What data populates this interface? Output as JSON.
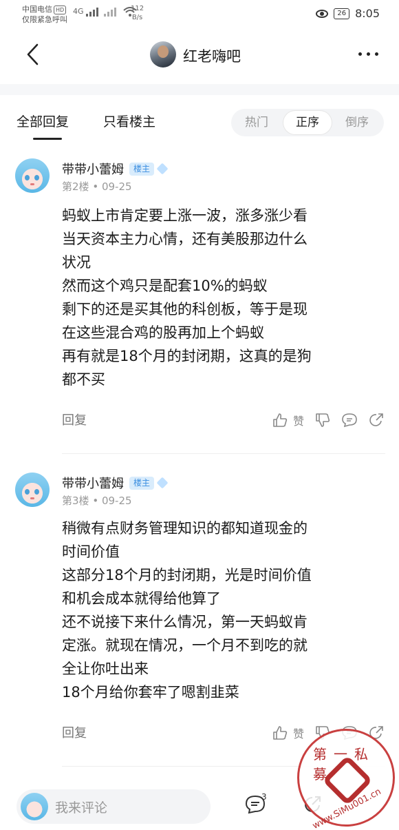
{
  "status_bar": {
    "carrier": "中国电信",
    "hd_badge": "HD",
    "emergency": "仅限紧急呼叫",
    "net_type": "4G",
    "speed_value": "112",
    "speed_unit": "B/s",
    "battery": "26",
    "time": "8:05"
  },
  "header": {
    "title": "红老嗨吧"
  },
  "tabs": {
    "all_replies": "全部回复",
    "op_only": "只看楼主",
    "sort_hot": "热门",
    "sort_asc": "正序",
    "sort_desc": "倒序"
  },
  "posts": [
    {
      "username": "带带小蕾姆",
      "badge": "楼主",
      "floor": "第2楼",
      "date": "09-25",
      "lines": [
        "蚂蚁上市肯定要上涨一波，涨多涨少看",
        "当天资本主力心情，还有美股那边什么",
        "状况",
        "然而这个鸡只是配套10%的蚂蚁",
        "剩下的还是买其他的科创板，等于是现",
        "在这些混合鸡的股再加上个蚂蚁",
        "再有就是18个月的封闭期，这真的是狗",
        "都不买"
      ],
      "reply_label": "回复",
      "like_label": "赞"
    },
    {
      "username": "带带小蕾姆",
      "badge": "楼主",
      "floor": "第3楼",
      "date": "09-25",
      "lines": [
        "稍微有点财务管理知识的都知道现金的",
        "时间价值",
        "这部分18个月的封闭期，光是时间价值",
        "和机会成本就得给他算了",
        "还不说接下来什么情况，第一天蚂蚁肯",
        "定涨。就现在情况，一个月不到吃的就",
        "全让你吐出来",
        "18个月给你套牢了嗯割韭菜"
      ],
      "reply_label": "回复",
      "like_label": "赞"
    }
  ],
  "bottom_bar": {
    "placeholder": "我来评论",
    "comment_count": "3"
  },
  "watermark": {
    "text": "第一私募",
    "url": "www.SiMu001.cn"
  }
}
